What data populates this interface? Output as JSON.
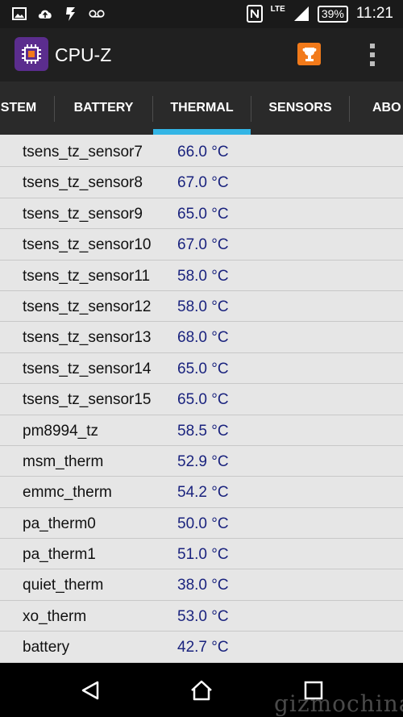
{
  "status_bar": {
    "network_label": "LTE",
    "battery_level": "39%",
    "time": "11:21",
    "left_icons": [
      "image-icon",
      "cloud-upload-icon",
      "usb-debug-icon",
      "voicemail-icon"
    ],
    "right_icons": [
      "nfc-icon",
      "signal-icon",
      "battery-icon"
    ]
  },
  "app_bar": {
    "title": "CPU-Z",
    "logo_icon": "cpu-chip-icon",
    "action_icons": [
      "trophy-icon",
      "overflow-menu-icon"
    ],
    "accent_color": "#f27a1a"
  },
  "tabs": {
    "items": [
      {
        "label": "STEM"
      },
      {
        "label": "BATTERY"
      },
      {
        "label": "THERMAL"
      },
      {
        "label": "SENSORS"
      },
      {
        "label": "ABO"
      }
    ],
    "selected": "THERMAL",
    "indicator_color": "#33b5e5"
  },
  "thermal": {
    "rows": [
      {
        "name": "tsens_tz_sensor7",
        "value": "66.0 °C"
      },
      {
        "name": "tsens_tz_sensor8",
        "value": "67.0 °C"
      },
      {
        "name": "tsens_tz_sensor9",
        "value": "65.0 °C"
      },
      {
        "name": "tsens_tz_sensor10",
        "value": "67.0 °C"
      },
      {
        "name": "tsens_tz_sensor11",
        "value": "58.0 °C"
      },
      {
        "name": "tsens_tz_sensor12",
        "value": "58.0 °C"
      },
      {
        "name": "tsens_tz_sensor13",
        "value": "68.0 °C"
      },
      {
        "name": "tsens_tz_sensor14",
        "value": "65.0 °C"
      },
      {
        "name": "tsens_tz_sensor15",
        "value": "65.0 °C"
      },
      {
        "name": "pm8994_tz",
        "value": "58.5 °C"
      },
      {
        "name": "msm_therm",
        "value": "52.9 °C"
      },
      {
        "name": "emmc_therm",
        "value": "54.2 °C"
      },
      {
        "name": "pa_therm0",
        "value": "50.0 °C"
      },
      {
        "name": "pa_therm1",
        "value": "51.0 °C"
      },
      {
        "name": "quiet_therm",
        "value": "38.0 °C"
      },
      {
        "name": "xo_therm",
        "value": "53.0 °C"
      },
      {
        "name": "battery",
        "value": "42.7 °C"
      }
    ]
  },
  "nav_bar": {
    "icons": [
      "back-icon",
      "home-icon",
      "recents-icon"
    ]
  },
  "watermark": "gizmochina"
}
